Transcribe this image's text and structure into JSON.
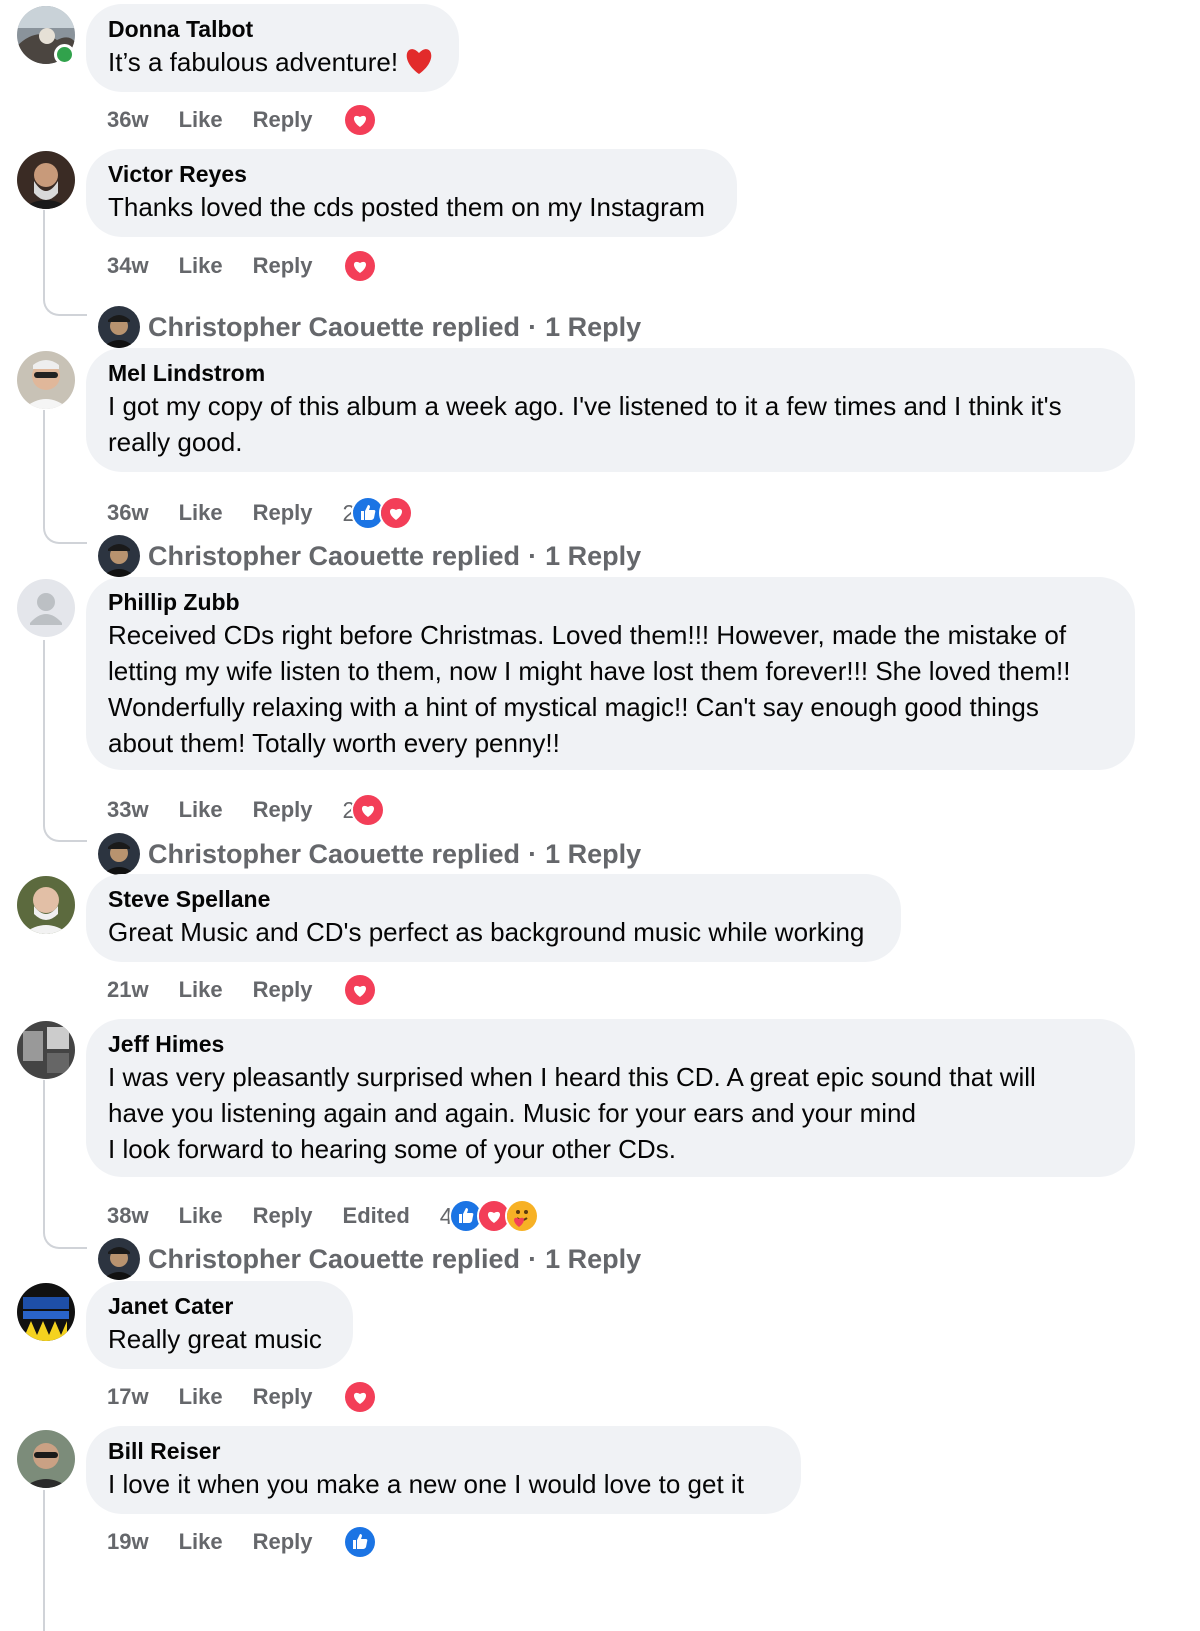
{
  "comments": [
    {
      "author": "Donna Talbot",
      "text": "It’s a fabulous adventure!",
      "time": "36w",
      "like": "Like",
      "reply": "Reply",
      "reaction_count": "",
      "edited": "",
      "reactions": [
        "heart"
      ],
      "avatar": "landscape-avatar",
      "online": true
    },
    {
      "author": "Victor Reyes",
      "text": "Thanks loved the cds posted them on my Instagram",
      "time": "34w",
      "like": "Like",
      "reply": "Reply",
      "reaction_count": "",
      "edited": "",
      "reactions": [
        "heart"
      ],
      "avatar": "person-avatar",
      "replied": {
        "name": "Christopher Caouette replied",
        "sep": "·",
        "count": "1 Reply"
      }
    },
    {
      "author": "Mel Lindstrom",
      "text": "I got my copy of this album a week ago. I've listened to it a few times and I think it's\nreally good.",
      "time": "36w",
      "like": "Like",
      "reply": "Reply",
      "reaction_count": "2",
      "edited": "",
      "reactions": [
        "like",
        "heart"
      ],
      "avatar": "person-avatar",
      "replied": {
        "name": "Christopher Caouette replied",
        "sep": "·",
        "count": "1 Reply"
      }
    },
    {
      "author": "Phillip Zubb",
      "text": "Received CDs right before Christmas. Loved them!!! However, made the mistake of\nletting my wife listen to them, now I might have lost them forever!!! She loved them!!\nWonderfully relaxing with a hint of mystical magic!! Can't say enough good things\nabout them! Totally worth every penny!!",
      "time": "33w",
      "like": "Like",
      "reply": "Reply",
      "reaction_count": "2",
      "edited": "",
      "reactions": [
        "heart"
      ],
      "avatar": "default-avatar",
      "replied": {
        "name": "Christopher Caouette replied",
        "sep": "·",
        "count": "1 Reply"
      }
    },
    {
      "author": "Steve Spellane",
      "text": "Great Music and CD's perfect as background music while working",
      "time": "21w",
      "like": "Like",
      "reply": "Reply",
      "reaction_count": "",
      "edited": "",
      "reactions": [
        "heart"
      ],
      "avatar": "person-avatar"
    },
    {
      "author": "Jeff Himes",
      "text": "I was very pleasantly surprised when I heard this CD. A great epic sound that will\nhave you listening again and again. Music for your ears and your mind\nI look forward to hearing some of your other CDs.",
      "time": "38w",
      "like": "Like",
      "reply": "Reply",
      "reaction_count": "4",
      "edited": "Edited",
      "reactions": [
        "like",
        "heart",
        "care"
      ],
      "avatar": "person-avatar",
      "replied": {
        "name": "Christopher Caouette replied",
        "sep": "·",
        "count": "1 Reply"
      }
    },
    {
      "author": "Janet Cater",
      "text": "Really great music",
      "time": "17w",
      "like": "Like",
      "reply": "Reply",
      "reaction_count": "",
      "edited": "",
      "reactions": [
        "heart"
      ],
      "avatar": "badge-avatar"
    },
    {
      "author": "Bill Reiser",
      "text": "I love it when you make a new one I would love to get it",
      "time": "19w",
      "like": "Like",
      "reply": "Reply",
      "reaction_count": "",
      "edited": "",
      "reactions": [
        "like"
      ],
      "avatar": "person-avatar"
    }
  ],
  "colors": {
    "bubble": "#f0f2f5",
    "meta_text": "#65676b",
    "like_blue": "#1b74e4",
    "heart_red": "#f33e58",
    "care_yellow": "#f7b125",
    "online_green": "#31a24c"
  }
}
